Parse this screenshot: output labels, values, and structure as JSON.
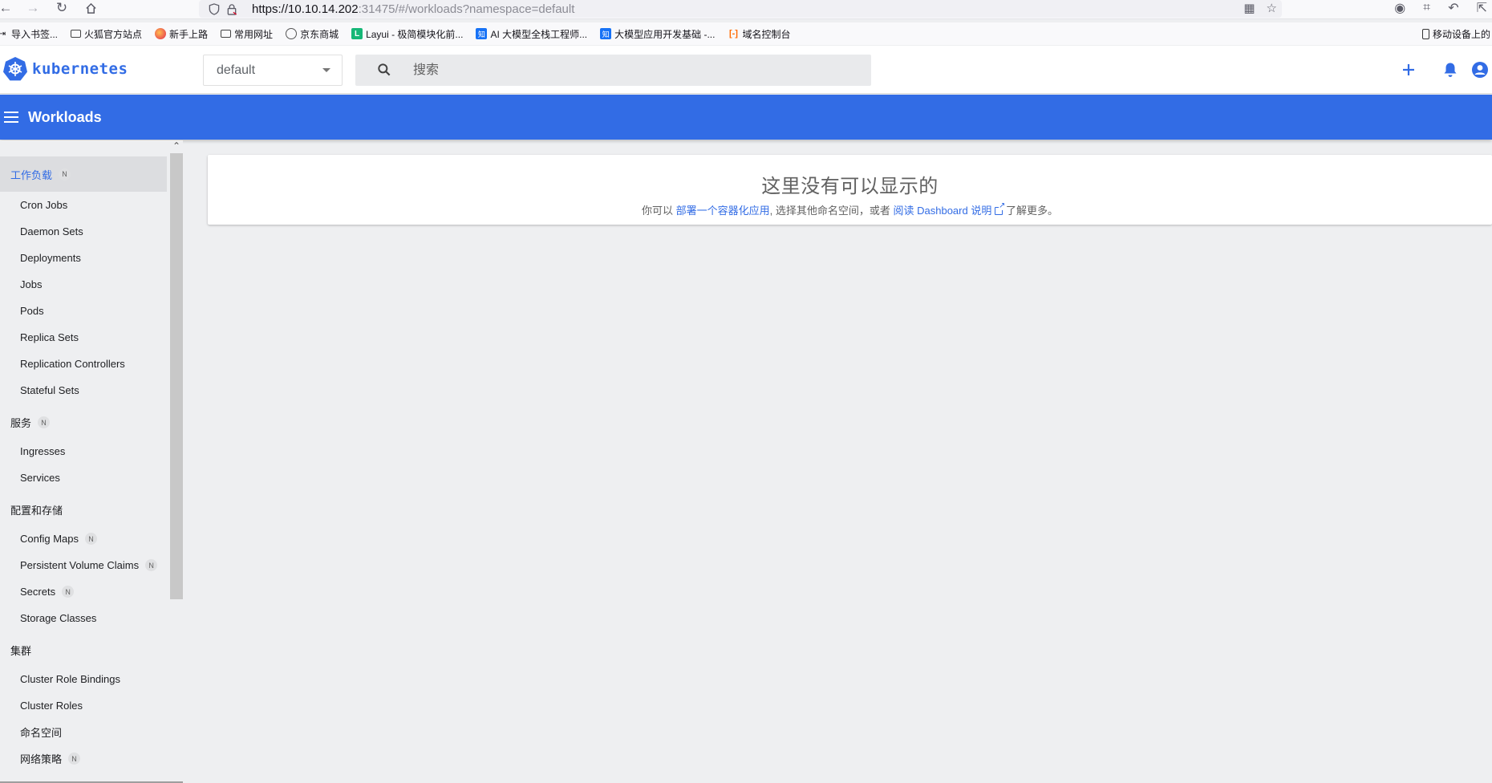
{
  "browser": {
    "url_host": "https://10.10.14.202",
    "url_rest": ":31475/#/workloads?namespace=default",
    "bookmarks": [
      {
        "label": "导入书签...",
        "icon": "import-icon"
      },
      {
        "label": "火狐官方站点",
        "icon": "folder-icon"
      },
      {
        "label": "新手上路",
        "icon": "firefox-icon"
      },
      {
        "label": "常用网址",
        "icon": "folder-icon"
      },
      {
        "label": "京东商城",
        "icon": "globe-icon"
      },
      {
        "label": "Layui - 极简模块化前...",
        "icon": "layui-icon"
      },
      {
        "label": "AI 大模型全栈工程师...",
        "icon": "zhihu-icon"
      },
      {
        "label": "大模型应用开发基础 -...",
        "icon": "zhihu-icon"
      },
      {
        "label": "域名控制台",
        "icon": "aliyun-icon"
      }
    ],
    "mobile_bookmarks": "移动设备上的"
  },
  "header": {
    "logo_text": "kubernetes",
    "namespace": "default",
    "search_placeholder": "搜索"
  },
  "titlebar": {
    "title": "Workloads"
  },
  "sidebar": {
    "sections": [
      {
        "label": "工作负载",
        "badge": "N",
        "active": true,
        "items": [
          {
            "label": "Cron Jobs"
          },
          {
            "label": "Daemon Sets"
          },
          {
            "label": "Deployments"
          },
          {
            "label": "Jobs"
          },
          {
            "label": "Pods"
          },
          {
            "label": "Replica Sets"
          },
          {
            "label": "Replication Controllers"
          },
          {
            "label": "Stateful Sets"
          }
        ]
      },
      {
        "label": "服务",
        "badge": "N",
        "items": [
          {
            "label": "Ingresses"
          },
          {
            "label": "Services"
          }
        ]
      },
      {
        "label": "配置和存储",
        "badge": "",
        "items": [
          {
            "label": "Config Maps",
            "badge": "N"
          },
          {
            "label": "Persistent Volume Claims",
            "badge": "N"
          },
          {
            "label": "Secrets",
            "badge": "N"
          },
          {
            "label": "Storage Classes"
          }
        ]
      },
      {
        "label": "集群",
        "badge": "",
        "items": [
          {
            "label": "Cluster Role Bindings"
          },
          {
            "label": "Cluster Roles"
          },
          {
            "label": "命名空间"
          },
          {
            "label": "网络策略",
            "badge": "N"
          }
        ]
      }
    ]
  },
  "content": {
    "empty_title": "这里没有可以显示的",
    "msg_prefix": "你可以 ",
    "msg_link1": "部署一个容器化应用",
    "msg_middle": ", 选择其他命名空间，或者 ",
    "msg_link2": "阅读 Dashboard 说明",
    "msg_suffix": " 了解更多。"
  },
  "colors": {
    "primary": "#326ce5",
    "page_bg": "#eeeff1"
  }
}
